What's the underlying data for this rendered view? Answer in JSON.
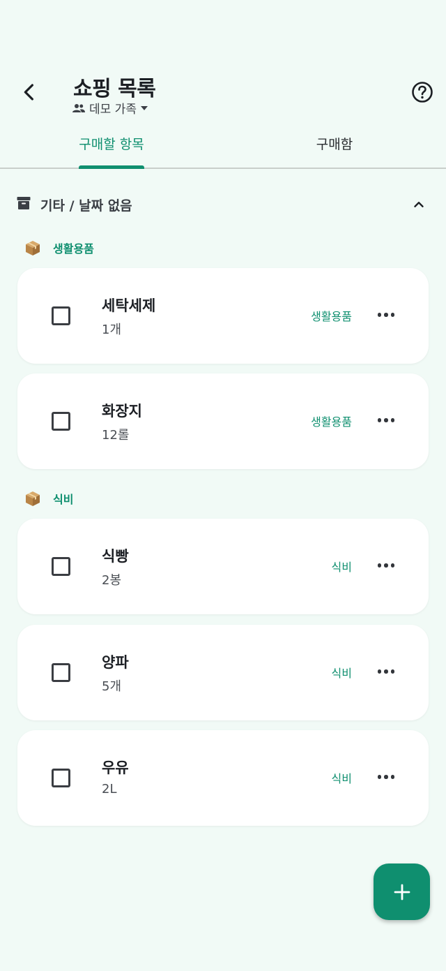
{
  "header": {
    "title": "쇼핑 목록",
    "group_name": "데모 가족"
  },
  "tabs": [
    {
      "label": "구매할 항목",
      "active": true
    },
    {
      "label": "구매함",
      "active": false
    }
  ],
  "section": {
    "title": "기타 / 날짜 없음",
    "expanded": true
  },
  "categories": [
    {
      "label": "생활용품",
      "icon": "package-icon",
      "items": [
        {
          "name": "세탁세제",
          "quantity": "1개",
          "category": "생활용품",
          "checked": false
        },
        {
          "name": "화장지",
          "quantity": "12롤",
          "category": "생활용품",
          "checked": false
        }
      ]
    },
    {
      "label": "식비",
      "icon": "package-icon",
      "items": [
        {
          "name": "식빵",
          "quantity": "2봉",
          "category": "식비",
          "checked": false
        },
        {
          "name": "양파",
          "quantity": "5개",
          "category": "식비",
          "checked": false
        },
        {
          "name": "우유",
          "quantity": "2L",
          "category": "식비",
          "checked": false
        }
      ]
    }
  ],
  "colors": {
    "accent": "#0f8f6f",
    "background": "#f1faf6",
    "card": "#ffffff"
  }
}
